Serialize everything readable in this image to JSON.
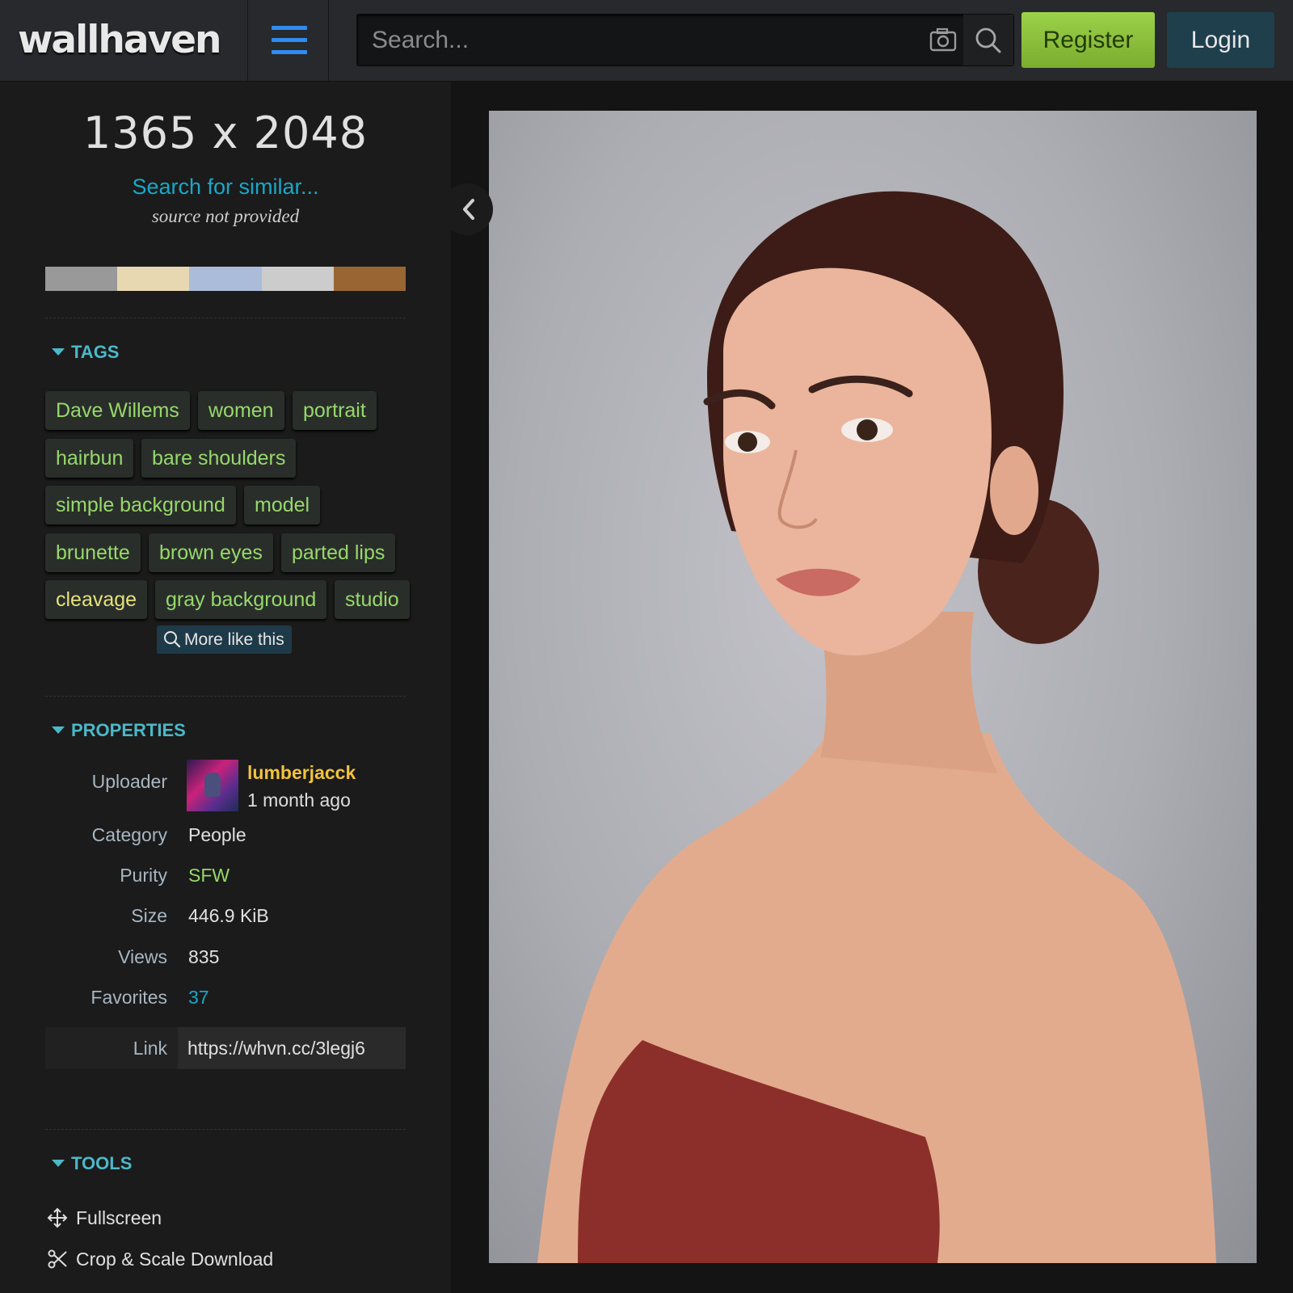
{
  "header": {
    "logo": "wallhaven",
    "search_placeholder": "Search...",
    "register_label": "Register",
    "login_label": "Login"
  },
  "sidebar": {
    "resolution": "1365 x 2048",
    "similar_link": "Search for similar...",
    "source_note": "source not provided",
    "palette": [
      "#999999",
      "#e7d8b1",
      "#abbcda",
      "#cccccc",
      "#996633"
    ],
    "tags_heading": "TAGS",
    "tags": [
      {
        "label": "Dave Willems",
        "status": "sfw"
      },
      {
        "label": "women",
        "status": "sfw"
      },
      {
        "label": "portrait",
        "status": "sfw"
      },
      {
        "label": "hairbun",
        "status": "sfw"
      },
      {
        "label": "bare shoulders",
        "status": "sfw"
      },
      {
        "label": "simple background",
        "status": "sfw"
      },
      {
        "label": "model",
        "status": "sfw"
      },
      {
        "label": "brunette",
        "status": "sfw"
      },
      {
        "label": "brown eyes",
        "status": "sfw"
      },
      {
        "label": "parted lips",
        "status": "sfw"
      },
      {
        "label": "cleavage",
        "status": "sketchy"
      },
      {
        "label": "gray background",
        "status": "sfw"
      },
      {
        "label": "studio",
        "status": "sfw"
      }
    ],
    "more_like_this": "More like this",
    "properties_heading": "PROPERTIES",
    "properties": {
      "uploader_label": "Uploader",
      "uploader_name": "lumberjacck",
      "uploader_time": "1 month ago",
      "category_label": "Category",
      "category_value": "People",
      "purity_label": "Purity",
      "purity_value": "SFW",
      "size_label": "Size",
      "size_value": "446.9 KiB",
      "views_label": "Views",
      "views_value": "835",
      "favorites_label": "Favorites",
      "favorites_value": "37",
      "link_label": "Link",
      "link_value": "https://whvn.cc/3legj6"
    },
    "tools_heading": "TOOLS",
    "tools": {
      "fullscreen": "Fullscreen",
      "crop": "Crop & Scale Download"
    }
  },
  "colors": {
    "accent_blue": "#2f8cf0",
    "register_green": "#8ec63f",
    "tag_green": "#96d96a",
    "uploader_gold": "#f2c23c",
    "link_cyan": "#18a8c8"
  }
}
